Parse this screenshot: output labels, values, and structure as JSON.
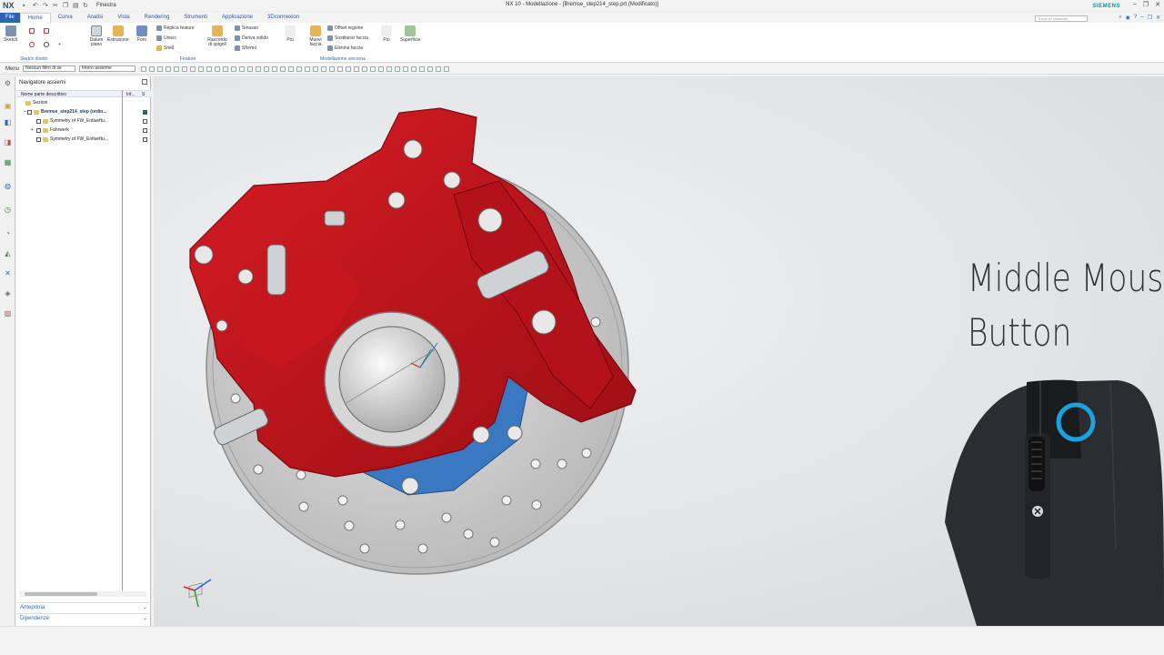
{
  "titlebar": {
    "logo": "NX",
    "window_menu": "Finestra",
    "title": "NX 10 - Modellazione - [Bremse_step214_step.prt (Modificato)]",
    "brand": "SIEMENS"
  },
  "tabs": [
    {
      "label": "File"
    },
    {
      "label": "Home"
    },
    {
      "label": "Curva"
    },
    {
      "label": "Analisi"
    },
    {
      "label": "Vista"
    },
    {
      "label": "Rendering"
    },
    {
      "label": "Strumenti"
    },
    {
      "label": "Applicazione"
    },
    {
      "label": "3Dconnexion"
    }
  ],
  "search": {
    "placeholder": "Trova un comando"
  },
  "ribbon": {
    "sketch": "Sketch",
    "datum": "Datum piano",
    "estrusione": "Estrusione",
    "foro": "Foro",
    "replica": "Replica feature",
    "unisci": "Unisci",
    "shell": "Shell",
    "raccordo": "Raccordo di spigoli",
    "smusso": "Smusso",
    "deriva": "Deriva solido",
    "sformo": "Sformo",
    "piu1": "Più",
    "muovi": "Muovi faccia",
    "offset": "Offset regione",
    "sostituisci": "Sostituisci faccia",
    "elimina": "Elimina faccia",
    "piu2": "Più",
    "superficie": "Superficie",
    "group_sketch": "Sketch diretto",
    "group_feature": "Feature",
    "group_sync": "Modellazione sincrona"
  },
  "toolbar": {
    "menu": "Menu",
    "filter": "Nessun filtro di se",
    "scope": "Intero assieme"
  },
  "navigator": {
    "title": "Navigatore assiemi",
    "col_name": "Nome parte descrittivo",
    "col_info": "Inf...",
    "col_s": "S",
    "rows": [
      {
        "label": "Sezioni"
      },
      {
        "label": "Bremse_step214_step (ordin..."
      },
      {
        "label": "Symmetry of FW_Entlueftu..."
      },
      {
        "label": "Fahrwerk"
      },
      {
        "label": "Symmetry of FW_Entlueftu..."
      }
    ],
    "preview": "Anteprima",
    "deps": "Dipendenze"
  },
  "overlay": {
    "line1": "Middle Mouse",
    "line2": "Button"
  },
  "colors": {
    "caliper": "#c0141c",
    "disc": "#c8c8c8",
    "carrier": "#3a78c2",
    "highlight": "#1aa3e0"
  }
}
